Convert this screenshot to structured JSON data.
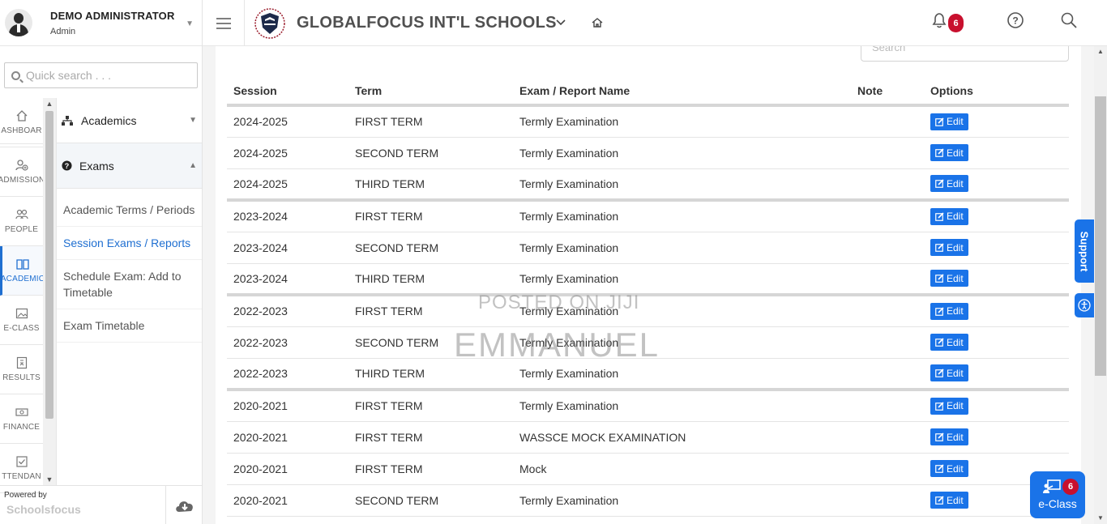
{
  "user": {
    "name": "DEMO ADMINISTRATOR",
    "role": "Admin"
  },
  "sidebar": {
    "quick_search_placeholder": "Quick search . . .",
    "rail": [
      {
        "label": "ASHBOAR",
        "icon": "home-icon"
      },
      {
        "label": "ADMISSION",
        "icon": "user-add-icon"
      },
      {
        "label": "PEOPLE",
        "icon": "people-icon"
      },
      {
        "label": "ACADEMIC",
        "icon": "book-icon"
      },
      {
        "label": "E-CLASS",
        "icon": "image-icon"
      },
      {
        "label": "RESULTS",
        "icon": "results-icon"
      },
      {
        "label": "FINANCE",
        "icon": "money-icon"
      },
      {
        "label": "TTENDAN",
        "icon": "checklist-icon"
      }
    ],
    "submenu": {
      "academics": "Academics",
      "exams": "Exams",
      "links": [
        "Academic Terms / Periods",
        "Session Exams / Reports",
        "Schedule Exam: Add to Timetable",
        "Exam Timetable"
      ]
    },
    "powered_by": "Powered by",
    "brand": "Schoolsfocus"
  },
  "header": {
    "school_name": "GLOBALFOCUS INT'L SCHOOLS",
    "notification_count": "6"
  },
  "table": {
    "search_placeholder": "Search",
    "columns": [
      "Session",
      "Term",
      "Exam / Report Name",
      "Note",
      "Options"
    ],
    "edit_label": "Edit",
    "rows": [
      {
        "session": "2024-2025",
        "term": "FIRST TERM",
        "exam": "Termly Examination",
        "note": ""
      },
      {
        "session": "2024-2025",
        "term": "SECOND TERM",
        "exam": "Termly Examination",
        "note": ""
      },
      {
        "session": "2024-2025",
        "term": "THIRD TERM",
        "exam": "Termly Examination",
        "note": ""
      },
      {
        "session": "2023-2024",
        "term": "FIRST TERM",
        "exam": "Termly Examination",
        "note": ""
      },
      {
        "session": "2023-2024",
        "term": "SECOND TERM",
        "exam": "Termly Examination",
        "note": ""
      },
      {
        "session": "2023-2024",
        "term": "THIRD TERM",
        "exam": "Termly Examination",
        "note": ""
      },
      {
        "session": "2022-2023",
        "term": "FIRST TERM",
        "exam": "Termly Examination",
        "note": ""
      },
      {
        "session": "2022-2023",
        "term": "SECOND TERM",
        "exam": "Termly Examination",
        "note": ""
      },
      {
        "session": "2022-2023",
        "term": "THIRD TERM",
        "exam": "Termly Examination",
        "note": ""
      },
      {
        "session": "2020-2021",
        "term": "FIRST TERM",
        "exam": "Termly Examination",
        "note": ""
      },
      {
        "session": "2020-2021",
        "term": "FIRST TERM",
        "exam": "WASSCE MOCK EXAMINATION",
        "note": ""
      },
      {
        "session": "2020-2021",
        "term": "FIRST TERM",
        "exam": "Mock",
        "note": ""
      },
      {
        "session": "2020-2021",
        "term": "SECOND TERM",
        "exam": "Termly Examination",
        "note": ""
      }
    ]
  },
  "widgets": {
    "support_label": "Support",
    "eclass_label": "e-Class",
    "eclass_count": "6"
  },
  "watermark": {
    "line1": "POSTED ON JIJI",
    "line2": "EMMANUEL"
  },
  "colors": {
    "accent": "#1a73e8",
    "badge": "#c8102e",
    "active_link": "#1f6fd1"
  }
}
